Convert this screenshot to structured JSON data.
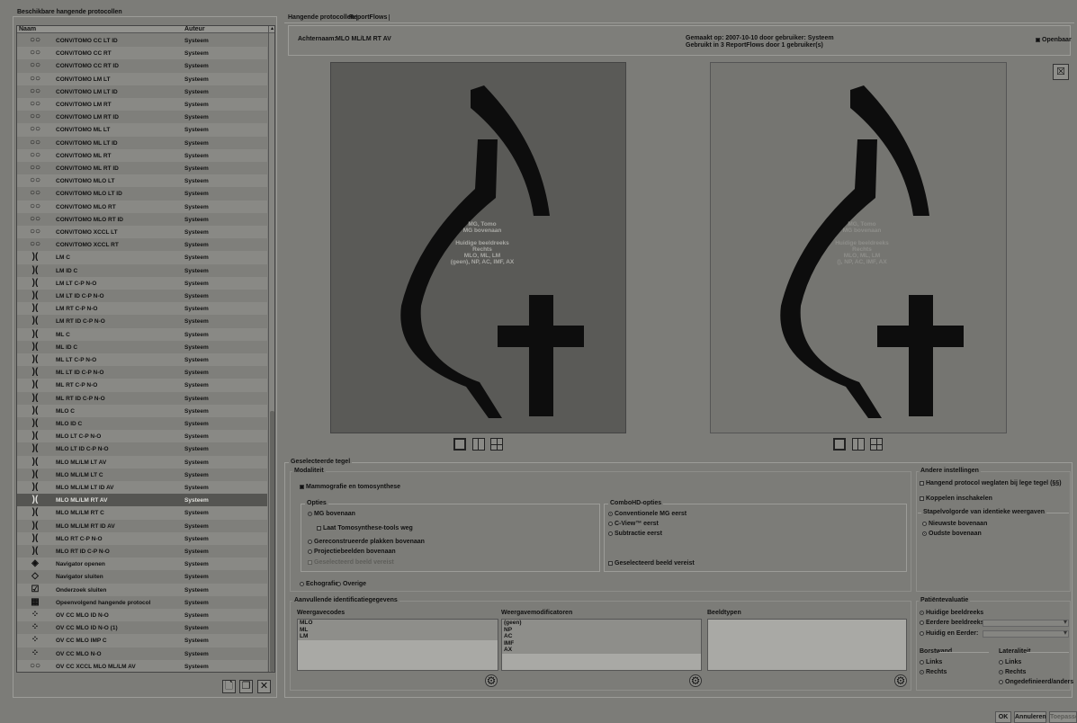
{
  "left_panel": {
    "title": "Beschikbare hangende protocollen",
    "col_name": "Naam",
    "col_author": "Auteur",
    "rows": [
      {
        "icon": "glasses-icon",
        "glyph": "○○",
        "name": "CONV/TOMO CC LT ID",
        "author": "Systeem"
      },
      {
        "icon": "glasses-icon",
        "glyph": "○○",
        "name": "CONV/TOMO CC RT",
        "author": "Systeem"
      },
      {
        "icon": "glasses-icon",
        "glyph": "○○",
        "name": "CONV/TOMO CC RT ID",
        "author": "Systeem"
      },
      {
        "icon": "glasses-icon",
        "glyph": "○○",
        "name": "CONV/TOMO LM LT",
        "author": "Systeem"
      },
      {
        "icon": "glasses-icon",
        "glyph": "○○",
        "name": "CONV/TOMO LM LT ID",
        "author": "Systeem"
      },
      {
        "icon": "glasses-icon",
        "glyph": "○○",
        "name": "CONV/TOMO LM RT",
        "author": "Systeem"
      },
      {
        "icon": "glasses-icon",
        "glyph": "○○",
        "name": "CONV/TOMO LM RT ID",
        "author": "Systeem"
      },
      {
        "icon": "glasses-icon",
        "glyph": "○○",
        "name": "CONV/TOMO ML LT",
        "author": "Systeem"
      },
      {
        "icon": "glasses-icon",
        "glyph": "○○",
        "name": "CONV/TOMO ML LT ID",
        "author": "Systeem"
      },
      {
        "icon": "glasses-icon",
        "glyph": "○○",
        "name": "CONV/TOMO ML RT",
        "author": "Systeem"
      },
      {
        "icon": "glasses-icon",
        "glyph": "○○",
        "name": "CONV/TOMO ML RT ID",
        "author": "Systeem"
      },
      {
        "icon": "glasses-icon",
        "glyph": "○○",
        "name": "CONV/TOMO MLO LT",
        "author": "Systeem"
      },
      {
        "icon": "glasses-icon",
        "glyph": "○○",
        "name": "CONV/TOMO MLO LT ID",
        "author": "Systeem"
      },
      {
        "icon": "glasses-icon",
        "glyph": "○○",
        "name": "CONV/TOMO MLO RT",
        "author": "Systeem"
      },
      {
        "icon": "glasses-icon",
        "glyph": "○○",
        "name": "CONV/TOMO MLO RT ID",
        "author": "Systeem"
      },
      {
        "icon": "glasses-icon",
        "glyph": "○○",
        "name": "CONV/TOMO XCCL LT",
        "author": "Systeem"
      },
      {
        "icon": "glasses-icon",
        "glyph": "○○",
        "name": "CONV/TOMO XCCL RT",
        "author": "Systeem"
      },
      {
        "icon": "breast-pair-icon",
        "glyph": ")(",
        "name": "LM C",
        "author": "Systeem"
      },
      {
        "icon": "breast-pair-icon",
        "glyph": ")(",
        "name": "LM ID C",
        "author": "Systeem"
      },
      {
        "icon": "breast-pair-icon",
        "glyph": ")(",
        "name": "LM LT C-P N-O",
        "author": "Systeem"
      },
      {
        "icon": "breast-pair-icon",
        "glyph": ")(",
        "name": "LM LT ID C-P N-O",
        "author": "Systeem"
      },
      {
        "icon": "breast-pair-icon",
        "glyph": ")(",
        "name": "LM RT C-P N-O",
        "author": "Systeem"
      },
      {
        "icon": "breast-pair-icon",
        "glyph": ")(",
        "name": "LM RT ID C-P N-O",
        "author": "Systeem"
      },
      {
        "icon": "breast-pair-icon",
        "glyph": ")(",
        "name": "ML C",
        "author": "Systeem"
      },
      {
        "icon": "breast-pair-icon",
        "glyph": ")(",
        "name": "ML ID C",
        "author": "Systeem"
      },
      {
        "icon": "breast-pair-icon",
        "glyph": ")(",
        "name": "ML LT C-P N-O",
        "author": "Systeem"
      },
      {
        "icon": "breast-pair-icon",
        "glyph": ")(",
        "name": "ML LT ID C-P N-O",
        "author": "Systeem"
      },
      {
        "icon": "breast-pair-icon",
        "glyph": ")(",
        "name": "ML RT C-P N-O",
        "author": "Systeem"
      },
      {
        "icon": "breast-pair-icon",
        "glyph": ")(",
        "name": "ML RT ID C-P N-O",
        "author": "Systeem"
      },
      {
        "icon": "breast-pair-icon",
        "glyph": ")(",
        "name": "MLO C",
        "author": "Systeem"
      },
      {
        "icon": "breast-pair-icon",
        "glyph": ")(",
        "name": "MLO ID C",
        "author": "Systeem"
      },
      {
        "icon": "breast-pair-icon",
        "glyph": ")(",
        "name": "MLO LT C-P N-O",
        "author": "Systeem"
      },
      {
        "icon": "breast-pair-icon",
        "glyph": ")(",
        "name": "MLO LT ID C-P N-O",
        "author": "Systeem"
      },
      {
        "icon": "breast-pair-icon",
        "glyph": ")(",
        "name": "MLO ML/LM LT AV",
        "author": "Systeem"
      },
      {
        "icon": "breast-pair-icon",
        "glyph": ")(",
        "name": "MLO ML/LM LT C",
        "author": "Systeem"
      },
      {
        "icon": "breast-pair-icon",
        "glyph": ")(",
        "name": "MLO ML/LM LT ID AV",
        "author": "Systeem"
      },
      {
        "icon": "breast-pair-icon",
        "glyph": ")(",
        "name": "MLO ML/LM RT AV",
        "author": "Systeem",
        "selected": true
      },
      {
        "icon": "breast-pair-icon",
        "glyph": ")(",
        "name": "MLO ML/LM RT C",
        "author": "Systeem"
      },
      {
        "icon": "breast-pair-icon",
        "glyph": ")(",
        "name": "MLO ML/LM RT ID AV",
        "author": "Systeem"
      },
      {
        "icon": "breast-pair-icon",
        "glyph": ")(",
        "name": "MLO RT C-P N-O",
        "author": "Systeem"
      },
      {
        "icon": "breast-pair-icon",
        "glyph": ")(",
        "name": "MLO RT ID C-P N-O",
        "author": "Systeem"
      },
      {
        "icon": "navigator-open-icon",
        "glyph": "◈",
        "name": "Navigator openen",
        "author": "Systeem"
      },
      {
        "icon": "navigator-close-icon",
        "glyph": "◇",
        "name": "Navigator sluiten",
        "author": "Systeem"
      },
      {
        "icon": "checkmark-icon",
        "glyph": "☑",
        "name": "Onderzoek sluiten",
        "author": "Systeem"
      },
      {
        "icon": "grid-next-icon",
        "glyph": "▦",
        "name": "Opeenvolgend hangende protocol",
        "author": "Systeem"
      },
      {
        "icon": "breast-grid-icon",
        "glyph": "⁘",
        "name": "OV CC MLO ID N-O",
        "author": "Systeem"
      },
      {
        "icon": "breast-grid-icon",
        "glyph": "⁘",
        "name": "OV CC MLO ID N-O (1)",
        "author": "Systeem"
      },
      {
        "icon": "breast-grid-icon",
        "glyph": "⁘",
        "name": "OV CC MLO IMP C",
        "author": "Systeem"
      },
      {
        "icon": "breast-grid-icon",
        "glyph": "⁘",
        "name": "OV CC MLO N-O",
        "author": "Systeem"
      },
      {
        "icon": "glasses-icon",
        "glyph": "○○",
        "name": "OV CC XCCL MLO ML/LM AV",
        "author": "Systeem"
      }
    ]
  },
  "tabs": [
    "Hangende protocollen",
    "ReportFlows"
  ],
  "info": {
    "achternaam_label": "Achternaam:",
    "achternaam_value": "MLO ML/LM RT AV",
    "created": "Gemaakt op: 2007-10-10 door gebruiker: Systeem",
    "used": "Gebruikt in 3 ReportFlows door 1 gebruiker(s)",
    "public": "Openbaar"
  },
  "viewports": {
    "left_lines": [
      "MG, Tomo",
      "MG bovenaan",
      "",
      "Huidige beeldreeks",
      "Rechts",
      "MLO, ML, LM",
      "(geen), NP, AC, IMF, AX"
    ],
    "right_lines": [
      "MG, Tomo",
      "MG bovenaan",
      "",
      "Huidige beeldreeks",
      "Rechts",
      "MLO, ML, LM",
      "(), NP, AC, IMF, AX"
    ]
  },
  "selected_tile": {
    "title": "Geselecteerde tegel",
    "modality_title": "Modaliteit",
    "mammo": "Mammografie en tomosynthese",
    "options_title": "Opties",
    "mg_top": "MG bovenaan",
    "hide_tomo": "Laat Tomosynthese-tools weg",
    "recon_top": "Gereconstrueerde plakken bovenaan",
    "proj_top": "Projectiebeelden bovenaan",
    "selected_required": "Geselecteerd beeld vereist",
    "combo_title": "ComboHD-opties",
    "conv_first": "Conventionele MG eerst",
    "cview_first": "C-View™ eerst",
    "subtr_first": "Subtractie eerst",
    "combo_sel_required": "Geselecteerd beeld vereist",
    "echo": "Echografie",
    "other": "Overige"
  },
  "other_settings": {
    "title": "Andere instellingen",
    "skip_empty": "Hangend protocol weglaten bij lege tegel (§§)",
    "linking": "Koppelen inschakelen",
    "stack_title": "Stapelvolgorde van identieke weergaven",
    "newest_top": "Nieuwste bovenaan",
    "oldest_top": "Oudste bovenaan"
  },
  "extra_ids": {
    "title": "Aanvullende identificatiegegevens",
    "view_codes_title": "Weergavecodes",
    "view_codes": [
      "MLO",
      "ML",
      "LM"
    ],
    "modifiers_title": "Weergavemodificatoren",
    "modifiers": [
      "(geen)",
      "NP",
      "AC",
      "IMF",
      "AX"
    ],
    "image_types_title": "Beeldtypen"
  },
  "patient_eval": {
    "title": "Patiëntevaluatie",
    "current": "Huidige beeldreeks",
    "earlier": "Eerdere beeldreeks:",
    "current_and_earlier": "Huidig en Eerder:",
    "chest_title": "Borstwand",
    "left": "Links",
    "right": "Rechts",
    "lat_title": "Lateraliteit",
    "lat_left": "Links",
    "lat_right": "Rechts",
    "lat_undefined": "Ongedefinieerd/anders"
  },
  "buttons": {
    "ok": "OK",
    "cancel": "Annuleren",
    "apply": "Toepassen"
  }
}
